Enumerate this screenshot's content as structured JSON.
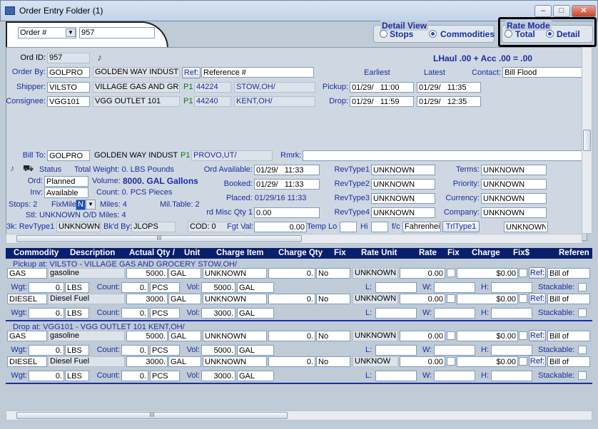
{
  "window": {
    "title": "Order Entry Folder (1)",
    "min": "–",
    "max": "□",
    "close": "✕"
  },
  "header": {
    "search_field_value": "Order #",
    "order_number": "957",
    "detail_view": {
      "title": "Detail View",
      "options": [
        "Stops",
        "Commodities"
      ],
      "selected": "Commodities"
    },
    "rate_mode": {
      "title": "Rate Mode",
      "options": [
        "Total",
        "Detail"
      ],
      "selected": "Detail"
    }
  },
  "order": {
    "ord_id_label": "Ord ID:",
    "ord_id": "957",
    "summary": "LHaul .00 + Acc .00 = .00",
    "order_by_label": "Order By:",
    "order_by": "GOLPRO",
    "order_by_name": "GOLDEN WAY INDUST",
    "ref_button": "Ref:",
    "ref_value": "Reference #",
    "earliest_label": "Earliest",
    "latest_label": "Latest",
    "contact_label": "Contact:",
    "contact": "Bill Flood",
    "shipper_label": "Shipper:",
    "shipper": "VILSTO",
    "shipper_name": "VILLAGE GAS AND GRC",
    "shipper_p": "P1",
    "shipper_zip": "44224",
    "shipper_city": "STOW,OH/",
    "pickup_label": "Pickup:",
    "pickup_earliest": "01/29/   11:00",
    "pickup_latest": "01/29/   11:35",
    "consignee_label": "Consignee:",
    "consignee": "VGG101",
    "consignee_name": "VGG OUTLET 101",
    "consignee_p": "P1",
    "consignee_zip": "44240",
    "consignee_city": "KENT,OH/",
    "drop_label": "Drop:",
    "drop_earliest": "01/29/   11:59",
    "drop_latest": "01/29/   12:35",
    "bill_to_label": "Bill To:",
    "bill_to": "GOLPRO",
    "bill_to_name": "GOLDEN WAY INDUST",
    "bill_to_p": "P1",
    "bill_to_city": "PROVO,UT/",
    "rmrk_label": "Rmrk:",
    "status_label": "Status",
    "total_weight": "Total Weight: 0. LBS Pounds",
    "ord_label": "Ord:",
    "ord_status": "Planned",
    "volume_label": "Volume:",
    "volume": "8000. GAL Gallons",
    "inv_label": "Inv:",
    "inv_status": "Available",
    "count": "Count: 0. PCS Pieces",
    "stops": "Stops: 2",
    "fixmile_label": "FixMile",
    "fixmile_value": "N",
    "miles": "Miles: 4",
    "miltable": "Mil.Table: 2",
    "stl": "Stl: UNKNOWN O/D Miles: 4",
    "ord_available_label": "Ord Available:",
    "ord_available": "01/29/   11:33",
    "booked_label": "Booked:",
    "booked": "01/29/   11:33",
    "placed": "Placed: 01/29/16 11:33",
    "rd_misc_label": "rd Misc Qty 1",
    "rd_misc": "0.00",
    "revtypes": [
      {
        "label": "RevType1",
        "value": "UNKNOWN"
      },
      {
        "label": "RevType2",
        "value": "UNKNOWN"
      },
      {
        "label": "RevType3",
        "value": "UNKNOWN"
      },
      {
        "label": "RevType4",
        "value": "UNKNOWN"
      }
    ],
    "terms_label": "Terms:",
    "terms": "UNKNOWN",
    "priority_label": "Priority:",
    "priority": "UNKNOWN",
    "currency_label": "Currency:",
    "currency": "UNKNOWN",
    "company_label": "Company:",
    "company": "UNKNOWN",
    "bk_revtype_label": "3k: RevType1",
    "bk_revtype": "UNKNOWN",
    "bkd_by_label": "Bk'd By:",
    "bkd_by": "JLOPS",
    "cod": "COD: 0",
    "fgt_val_label": "Fgt Val:",
    "fgt_val": "0.00",
    "temp_lo_label": "Temp Lo",
    "hi_label": "Hi",
    "fc_label": "f/c",
    "fc_value": "Fahrenheit",
    "trltype_button": "TrlType1",
    "trltype_value": "UNKNOWN"
  },
  "grid": {
    "columns": [
      "Commodity",
      "Description",
      "Actual Qty /",
      "Unit",
      "Charge Item",
      "Charge Qty",
      "Fix",
      "Rate Unit",
      "Rate",
      "Fix",
      "Charge",
      "Fix$",
      "Referen"
    ],
    "labels": {
      "wgt": "Wgt:",
      "count": "Count:",
      "vol": "Vol:",
      "l": "L:",
      "w": "W:",
      "h": "H:",
      "stackable": "Stackable:",
      "ref": "Ref:"
    },
    "stops": [
      {
        "header": "Pickup at: VILSTO - VILLAGE GAS AND GROCERY   STOW,OH/",
        "rows": [
          {
            "commodity": "GAS",
            "description": "gasoline",
            "qty": "5000.",
            "unit": "GAL",
            "charge_item": "UNKNOWN",
            "charge_qty": "0.",
            "fix": "No",
            "rate_unit": "UNKNOWN",
            "rate": "0.00",
            "charge": "$0.00",
            "reference": "Bill of",
            "wgt": "0.",
            "wgt_unit": "LBS",
            "count": "0.",
            "count_unit": "PCS",
            "vol": "5000.",
            "vol_unit": "GAL"
          },
          {
            "commodity": "DIESEL",
            "description": "Diesel Fuel",
            "qty": "3000.",
            "unit": "GAL",
            "charge_item": "UNKNOWN",
            "charge_qty": "0.",
            "fix": "No",
            "rate_unit": "UNKNOWN",
            "rate": "0.00",
            "charge": "$0.00",
            "reference": "Bill of",
            "wgt": "0.",
            "wgt_unit": "LBS",
            "count": "0.",
            "count_unit": "PCS",
            "vol": "3000.",
            "vol_unit": "GAL"
          }
        ]
      },
      {
        "header": "Drop at: VGG101 - VGG OUTLET 101   KENT,OH/",
        "rows": [
          {
            "commodity": "GAS",
            "description": "gasoline",
            "qty": "5000.",
            "unit": "GAL",
            "charge_item": "UNKNOWN",
            "charge_qty": "0.",
            "fix": "No",
            "rate_unit": "UNKNOWN",
            "rate": "0.00",
            "charge": "$0.00",
            "reference": "Bill of",
            "wgt": "0.",
            "wgt_unit": "LBS",
            "count": "0.",
            "count_unit": "PCS",
            "vol": "5000.",
            "vol_unit": "GAL"
          },
          {
            "commodity": "DIESEL",
            "description": "Diesel Fuel",
            "qty": "3000.",
            "unit": "GAL",
            "charge_item": "UNKNOWN",
            "charge_qty": "0.",
            "fix": "No",
            "rate_unit": "UNKNOW",
            "rate": "0.00",
            "charge": "$0.00",
            "reference": "Bill of",
            "wgt": "0.",
            "wgt_unit": "LBS",
            "count": "0.",
            "count_unit": "PCS",
            "vol": "3000.",
            "vol_unit": "GAL"
          }
        ]
      }
    ]
  },
  "scroll_thumb": "III"
}
